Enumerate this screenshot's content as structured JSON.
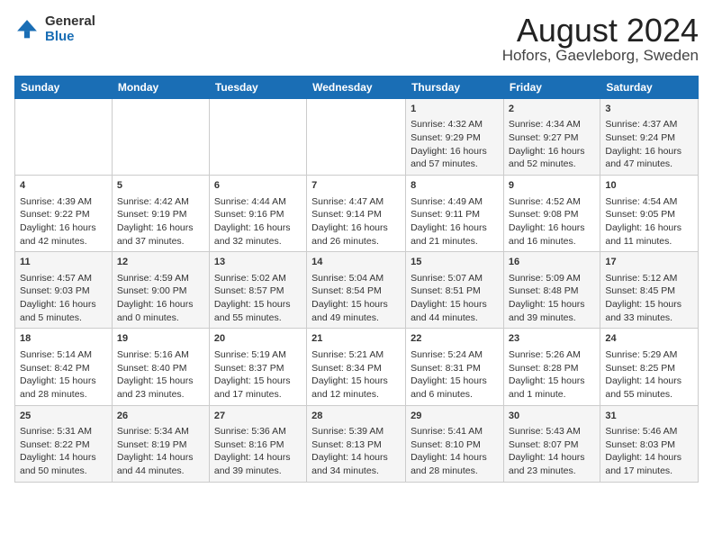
{
  "header": {
    "logo_line1": "General",
    "logo_line2": "Blue",
    "title": "August 2024",
    "subtitle": "Hofors, Gaevleborg, Sweden"
  },
  "days_of_week": [
    "Sunday",
    "Monday",
    "Tuesday",
    "Wednesday",
    "Thursday",
    "Friday",
    "Saturday"
  ],
  "weeks": [
    [
      {
        "day": "",
        "content": ""
      },
      {
        "day": "",
        "content": ""
      },
      {
        "day": "",
        "content": ""
      },
      {
        "day": "",
        "content": ""
      },
      {
        "day": "1",
        "content": "Sunrise: 4:32 AM\nSunset: 9:29 PM\nDaylight: 16 hours and 57 minutes."
      },
      {
        "day": "2",
        "content": "Sunrise: 4:34 AM\nSunset: 9:27 PM\nDaylight: 16 hours and 52 minutes."
      },
      {
        "day": "3",
        "content": "Sunrise: 4:37 AM\nSunset: 9:24 PM\nDaylight: 16 hours and 47 minutes."
      }
    ],
    [
      {
        "day": "4",
        "content": "Sunrise: 4:39 AM\nSunset: 9:22 PM\nDaylight: 16 hours and 42 minutes."
      },
      {
        "day": "5",
        "content": "Sunrise: 4:42 AM\nSunset: 9:19 PM\nDaylight: 16 hours and 37 minutes."
      },
      {
        "day": "6",
        "content": "Sunrise: 4:44 AM\nSunset: 9:16 PM\nDaylight: 16 hours and 32 minutes."
      },
      {
        "day": "7",
        "content": "Sunrise: 4:47 AM\nSunset: 9:14 PM\nDaylight: 16 hours and 26 minutes."
      },
      {
        "day": "8",
        "content": "Sunrise: 4:49 AM\nSunset: 9:11 PM\nDaylight: 16 hours and 21 minutes."
      },
      {
        "day": "9",
        "content": "Sunrise: 4:52 AM\nSunset: 9:08 PM\nDaylight: 16 hours and 16 minutes."
      },
      {
        "day": "10",
        "content": "Sunrise: 4:54 AM\nSunset: 9:05 PM\nDaylight: 16 hours and 11 minutes."
      }
    ],
    [
      {
        "day": "11",
        "content": "Sunrise: 4:57 AM\nSunset: 9:03 PM\nDaylight: 16 hours and 5 minutes."
      },
      {
        "day": "12",
        "content": "Sunrise: 4:59 AM\nSunset: 9:00 PM\nDaylight: 16 hours and 0 minutes."
      },
      {
        "day": "13",
        "content": "Sunrise: 5:02 AM\nSunset: 8:57 PM\nDaylight: 15 hours and 55 minutes."
      },
      {
        "day": "14",
        "content": "Sunrise: 5:04 AM\nSunset: 8:54 PM\nDaylight: 15 hours and 49 minutes."
      },
      {
        "day": "15",
        "content": "Sunrise: 5:07 AM\nSunset: 8:51 PM\nDaylight: 15 hours and 44 minutes."
      },
      {
        "day": "16",
        "content": "Sunrise: 5:09 AM\nSunset: 8:48 PM\nDaylight: 15 hours and 39 minutes."
      },
      {
        "day": "17",
        "content": "Sunrise: 5:12 AM\nSunset: 8:45 PM\nDaylight: 15 hours and 33 minutes."
      }
    ],
    [
      {
        "day": "18",
        "content": "Sunrise: 5:14 AM\nSunset: 8:42 PM\nDaylight: 15 hours and 28 minutes."
      },
      {
        "day": "19",
        "content": "Sunrise: 5:16 AM\nSunset: 8:40 PM\nDaylight: 15 hours and 23 minutes."
      },
      {
        "day": "20",
        "content": "Sunrise: 5:19 AM\nSunset: 8:37 PM\nDaylight: 15 hours and 17 minutes."
      },
      {
        "day": "21",
        "content": "Sunrise: 5:21 AM\nSunset: 8:34 PM\nDaylight: 15 hours and 12 minutes."
      },
      {
        "day": "22",
        "content": "Sunrise: 5:24 AM\nSunset: 8:31 PM\nDaylight: 15 hours and 6 minutes."
      },
      {
        "day": "23",
        "content": "Sunrise: 5:26 AM\nSunset: 8:28 PM\nDaylight: 15 hours and 1 minute."
      },
      {
        "day": "24",
        "content": "Sunrise: 5:29 AM\nSunset: 8:25 PM\nDaylight: 14 hours and 55 minutes."
      }
    ],
    [
      {
        "day": "25",
        "content": "Sunrise: 5:31 AM\nSunset: 8:22 PM\nDaylight: 14 hours and 50 minutes."
      },
      {
        "day": "26",
        "content": "Sunrise: 5:34 AM\nSunset: 8:19 PM\nDaylight: 14 hours and 44 minutes."
      },
      {
        "day": "27",
        "content": "Sunrise: 5:36 AM\nSunset: 8:16 PM\nDaylight: 14 hours and 39 minutes."
      },
      {
        "day": "28",
        "content": "Sunrise: 5:39 AM\nSunset: 8:13 PM\nDaylight: 14 hours and 34 minutes."
      },
      {
        "day": "29",
        "content": "Sunrise: 5:41 AM\nSunset: 8:10 PM\nDaylight: 14 hours and 28 minutes."
      },
      {
        "day": "30",
        "content": "Sunrise: 5:43 AM\nSunset: 8:07 PM\nDaylight: 14 hours and 23 minutes."
      },
      {
        "day": "31",
        "content": "Sunrise: 5:46 AM\nSunset: 8:03 PM\nDaylight: 14 hours and 17 minutes."
      }
    ]
  ]
}
